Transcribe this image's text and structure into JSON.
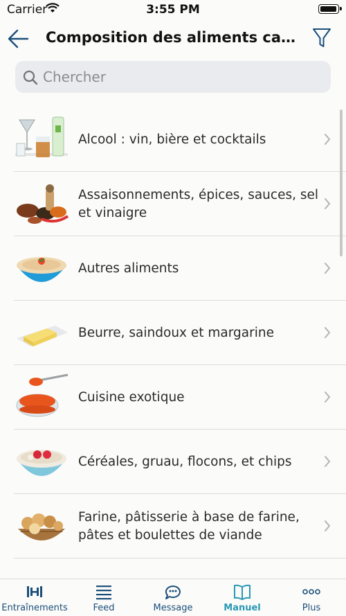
{
  "status_bar": {
    "carrier": "Carrier",
    "time": "3:55 PM",
    "battery_level": 1.0
  },
  "nav": {
    "title": "Composition des aliments cal...",
    "back_icon": "arrow-left-icon",
    "filter_icon": "filter-icon"
  },
  "search": {
    "placeholder": "Chercher",
    "value": ""
  },
  "categories": [
    {
      "label": "Alcool : vin, bière et cocktails",
      "icon": "drinks-image"
    },
    {
      "label": "Assaisonnements, épices, sauces, sel et vinaigre",
      "icon": "spices-image"
    },
    {
      "label": "Autres aliments",
      "icon": "bowl-image"
    },
    {
      "label": "Beurre, saindoux et margarine",
      "icon": "butter-image"
    },
    {
      "label": "Cuisine exotique",
      "icon": "caviar-image"
    },
    {
      "label": "Céréales, gruau, flocons, et chips",
      "icon": "porridge-image"
    },
    {
      "label": "Farine, pâtisserie à base de farine, pâtes et boulettes de viande",
      "icon": "bread-basket-image"
    },
    {
      "label": "",
      "icon": "partial-row-image"
    }
  ],
  "tabs": [
    {
      "label": "Entraînements",
      "icon": "dumbbell-icon",
      "active": false
    },
    {
      "label": "Feed",
      "icon": "list-icon",
      "active": false
    },
    {
      "label": "Message",
      "icon": "chat-icon",
      "active": false
    },
    {
      "label": "Manuel",
      "icon": "book-icon",
      "active": true
    },
    {
      "label": "Plus",
      "icon": "more-icon",
      "active": false
    }
  ],
  "colors": {
    "accent": "#2a98b4",
    "primary": "#1a4e7a",
    "search_bg": "#e9ebee"
  }
}
